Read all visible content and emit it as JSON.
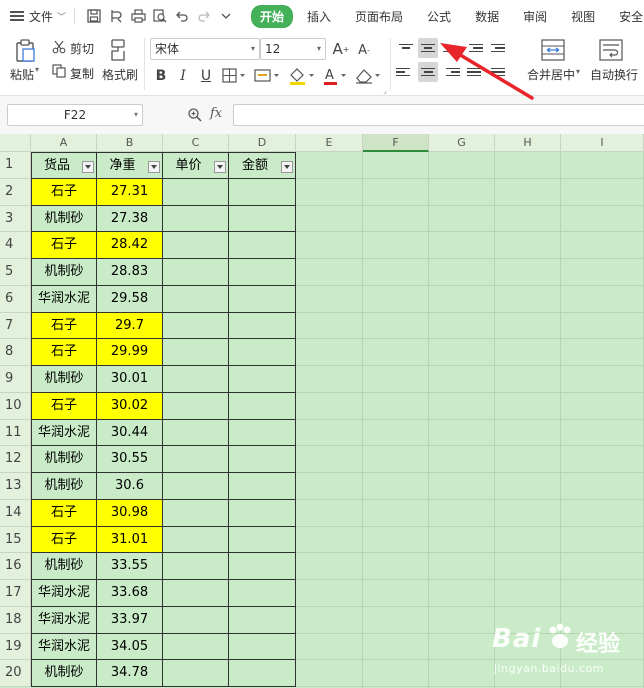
{
  "menubar": {
    "file_label": "文件",
    "tabs": [
      {
        "label": "开始",
        "active": true
      },
      {
        "label": "插入"
      },
      {
        "label": "页面布局"
      },
      {
        "label": "公式"
      },
      {
        "label": "数据"
      },
      {
        "label": "审阅"
      },
      {
        "label": "视图"
      },
      {
        "label": "安全"
      }
    ]
  },
  "ribbon": {
    "paste_label": "粘贴",
    "cut_label": "剪切",
    "copy_label": "复制",
    "format_painter_label": "格式刷",
    "font_name": "宋体",
    "font_size": "12",
    "merge_label": "合并居中",
    "wrap_label": "自动换行",
    "bold": "B",
    "italic": "I",
    "underline": "U"
  },
  "formula_bar": {
    "name_box": "F22",
    "fx_label": "fx",
    "formula": ""
  },
  "grid": {
    "columns": [
      "A",
      "B",
      "C",
      "D",
      "E",
      "F",
      "G",
      "H",
      "I"
    ],
    "selected_column": "F",
    "headers": [
      "货品",
      "净重",
      "单价",
      "金额"
    ],
    "rows": [
      {
        "num": "1"
      },
      {
        "num": "2",
        "item": "石子",
        "weight": "27.31",
        "highlight": true
      },
      {
        "num": "3",
        "item": "机制砂",
        "weight": "27.38",
        "highlight": false
      },
      {
        "num": "4",
        "item": "石子",
        "weight": "28.42",
        "highlight": true
      },
      {
        "num": "5",
        "item": "机制砂",
        "weight": "28.83",
        "highlight": false
      },
      {
        "num": "6",
        "item": "华润水泥",
        "weight": "29.58",
        "highlight": false
      },
      {
        "num": "7",
        "item": "石子",
        "weight": "29.7",
        "highlight": true
      },
      {
        "num": "8",
        "item": "石子",
        "weight": "29.99",
        "highlight": true
      },
      {
        "num": "9",
        "item": "机制砂",
        "weight": "30.01",
        "highlight": false
      },
      {
        "num": "10",
        "item": "石子",
        "weight": "30.02",
        "highlight": true
      },
      {
        "num": "11",
        "item": "华润水泥",
        "weight": "30.44",
        "highlight": false
      },
      {
        "num": "12",
        "item": "机制砂",
        "weight": "30.55",
        "highlight": false
      },
      {
        "num": "13",
        "item": "机制砂",
        "weight": "30.6",
        "highlight": false
      },
      {
        "num": "14",
        "item": "石子",
        "weight": "30.98",
        "highlight": true
      },
      {
        "num": "15",
        "item": "石子",
        "weight": "31.01",
        "highlight": true
      },
      {
        "num": "16",
        "item": "机制砂",
        "weight": "33.55",
        "highlight": false
      },
      {
        "num": "17",
        "item": "华润水泥",
        "weight": "33.68",
        "highlight": false
      },
      {
        "num": "18",
        "item": "华润水泥",
        "weight": "33.97",
        "highlight": false
      },
      {
        "num": "19",
        "item": "华润水泥",
        "weight": "34.05",
        "highlight": false
      },
      {
        "num": "20",
        "item": "机制砂",
        "weight": "34.78",
        "highlight": false
      }
    ]
  },
  "watermark": {
    "brand": "Bai",
    "brand_cn": "经验",
    "url": "jingyan.baidu.com"
  },
  "colors": {
    "accent": "#45b05a",
    "grid_bg": "#c9ebc7",
    "highlight": "#ffff00",
    "arrow": "#e8252a"
  }
}
